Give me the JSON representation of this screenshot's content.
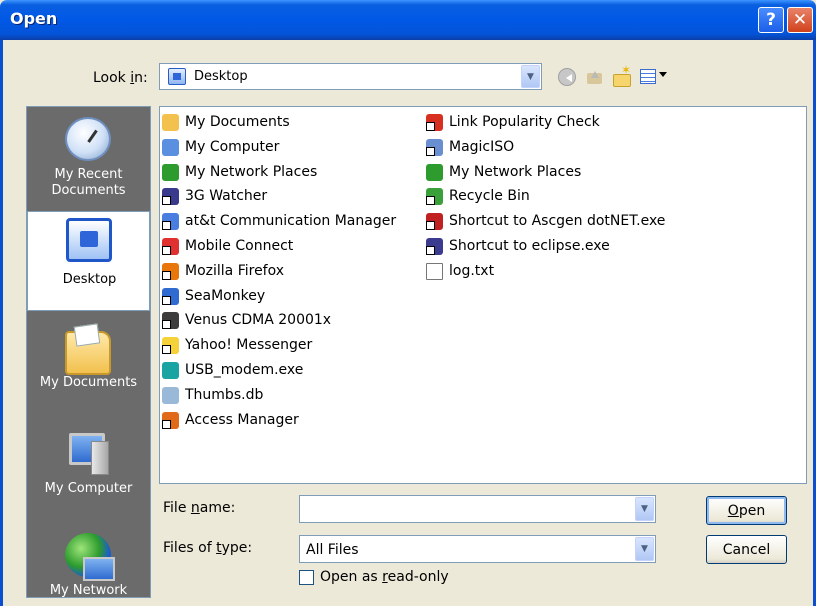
{
  "window": {
    "title": "Open",
    "help_glyph": "?",
    "close_glyph": "✕"
  },
  "toolbar": {
    "look_in_label": "Look in:",
    "look_in_value": "Desktop",
    "icons": [
      "back-icon",
      "up-folder-icon",
      "new-folder-icon",
      "views-menu-icon"
    ]
  },
  "places": [
    {
      "label": "My Recent Documents",
      "icon": "recent-documents-icon"
    },
    {
      "label": "Desktop",
      "icon": "desktop-icon",
      "selected": true
    },
    {
      "label": "My Documents",
      "icon": "my-documents-icon"
    },
    {
      "label": "My Computer",
      "icon": "my-computer-icon"
    },
    {
      "label": "My Network",
      "icon": "my-network-icon"
    }
  ],
  "files": [
    {
      "name": "My Documents",
      "icon": "folder-documents-icon",
      "color": "#f2c14e"
    },
    {
      "name": "My Computer",
      "icon": "computer-icon",
      "color": "#5b8fe0"
    },
    {
      "name": "My Network Places",
      "icon": "network-places-icon",
      "color": "#2d9b2d"
    },
    {
      "name": "3G Watcher",
      "icon": "3g-watcher-icon",
      "color": "#3a3a8c"
    },
    {
      "name": "at&t Communication Manager",
      "icon": "att-icon",
      "color": "#4a7de0"
    },
    {
      "name": "Mobile Connect",
      "icon": "mobile-connect-icon",
      "color": "#e03030"
    },
    {
      "name": "Mozilla Firefox",
      "icon": "firefox-icon",
      "color": "#e8760a"
    },
    {
      "name": "SeaMonkey",
      "icon": "seamonkey-icon",
      "color": "#2f6bd0"
    },
    {
      "name": "Venus CDMA 20001x",
      "icon": "venus-icon",
      "color": "#3c3c3c"
    },
    {
      "name": "Yahoo! Messenger",
      "icon": "yahoo-messenger-icon",
      "color": "#f5d13a"
    },
    {
      "name": "USB_modem.exe",
      "icon": "usb-modem-icon",
      "color": "#1aa3a3"
    },
    {
      "name": "Thumbs.db",
      "icon": "thumbs-db-icon",
      "color": "#9ab8d8"
    },
    {
      "name": "Access Manager",
      "icon": "access-manager-icon",
      "color": "#e06a1a"
    },
    {
      "name": "Link Popularity Check",
      "icon": "link-popularity-icon",
      "color": "#d83020"
    },
    {
      "name": "MagicISO",
      "icon": "magiciso-icon",
      "color": "#6a8fd0"
    },
    {
      "name": "My Network Places",
      "icon": "network-places-icon",
      "color": "#2d9b2d"
    },
    {
      "name": "Recycle Bin",
      "icon": "recycle-bin-icon",
      "color": "#3aa03a"
    },
    {
      "name": "Shortcut to Ascgen dotNET.exe",
      "icon": "ascgen-icon",
      "color": "#c02020"
    },
    {
      "name": "Shortcut to eclipse.exe",
      "icon": "eclipse-icon",
      "color": "#3b3b8f"
    },
    {
      "name": "log.txt",
      "icon": "text-file-icon",
      "color": "#ffffff"
    }
  ],
  "form": {
    "file_name_label": "File name:",
    "file_name_value": "",
    "file_type_label": "Files of type:",
    "file_type_value": "All Files",
    "read_only_label": "Open as read-only",
    "read_only_checked": false
  },
  "buttons": {
    "open": "Open",
    "cancel": "Cancel"
  },
  "colors": {
    "title_bar": "#0058e6",
    "dialog_bg": "#ece9d8",
    "places_bar": "#6b6b6b",
    "border": "#7f9db9"
  }
}
